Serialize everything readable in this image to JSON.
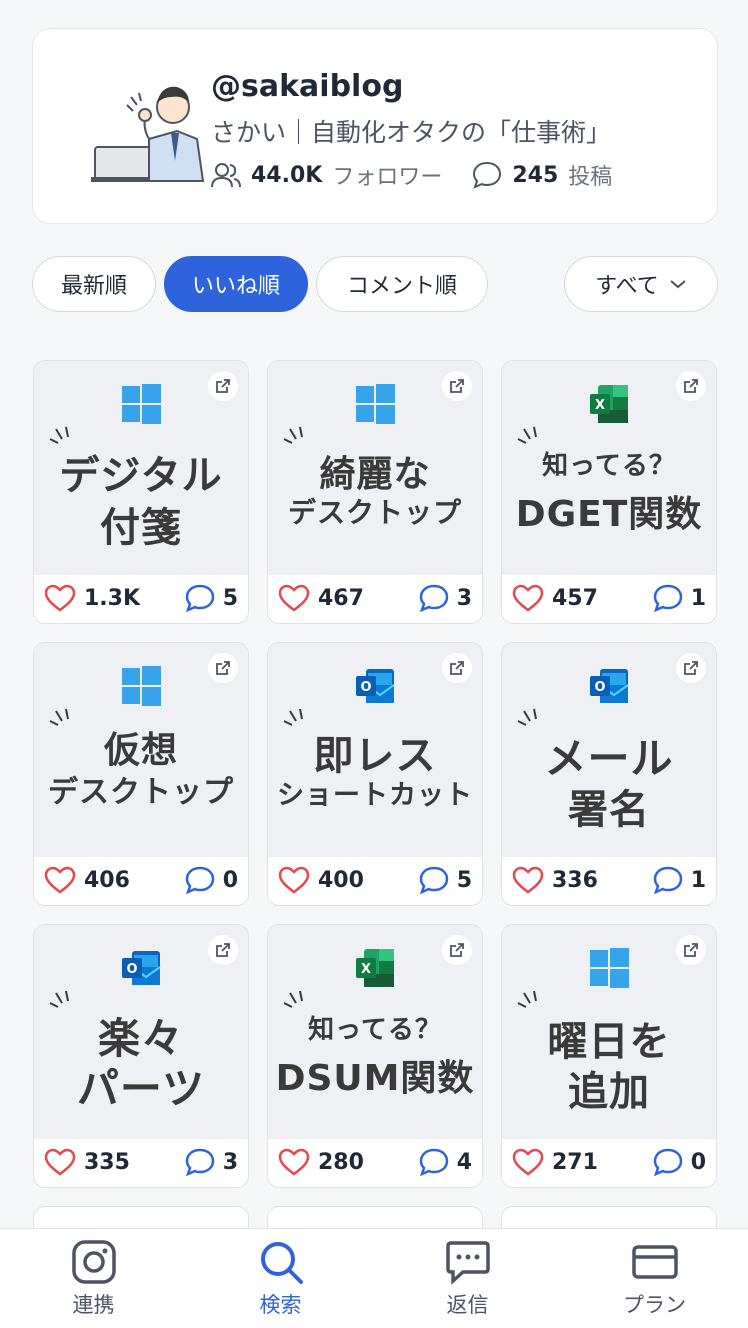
{
  "profile": {
    "handle": "@sakaiblog",
    "bio": "さかい｜自動化オタクの「仕事術」",
    "followers_count": "44.0K",
    "followers_label": "フォロワー",
    "posts_count": "245",
    "posts_label": "投稿"
  },
  "filters": {
    "newest": "最新順",
    "likes": "いいね順",
    "comments": "コメント順",
    "all": "すべて"
  },
  "posts": [
    {
      "app": "windows",
      "line1": "デジタル",
      "line2": "付箋",
      "likes": "1.3K",
      "comments": "5"
    },
    {
      "app": "windows",
      "line1": "綺麗な",
      "line2": "デスクトップ",
      "likes": "467",
      "comments": "3"
    },
    {
      "app": "excel",
      "line1": "知ってる？",
      "line2": "DGET関数",
      "likes": "457",
      "comments": "1"
    },
    {
      "app": "windows",
      "line1": "仮想",
      "line2": "デスクトップ",
      "likes": "406",
      "comments": "0"
    },
    {
      "app": "outlook",
      "line1": "即レス",
      "line2": "ショートカット",
      "likes": "400",
      "comments": "5"
    },
    {
      "app": "outlook",
      "line1": "メール",
      "line2": "署名",
      "likes": "336",
      "comments": "1"
    },
    {
      "app": "outlook",
      "line1": "楽々",
      "line2": "パーツ",
      "likes": "335",
      "comments": "3"
    },
    {
      "app": "excel",
      "line1": "知ってる？",
      "line2": "DSUM関数",
      "likes": "280",
      "comments": "4"
    },
    {
      "app": "windows",
      "line1": "曜日を",
      "line2": "追加",
      "likes": "271",
      "comments": "0"
    }
  ],
  "nav": {
    "connect": "連携",
    "search": "検索",
    "reply": "返信",
    "plan": "プラン"
  },
  "colors": {
    "accent": "#2f63db",
    "heart": "#e5484d",
    "comment": "#2f63db"
  }
}
